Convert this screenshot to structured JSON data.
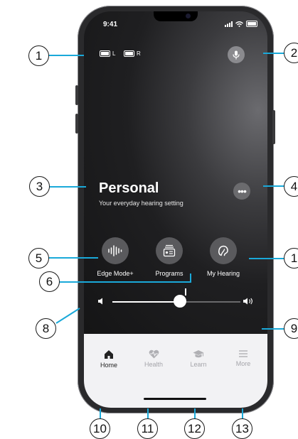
{
  "status_bar": {
    "time": "9:41"
  },
  "hearing_aids": {
    "left_label": "L",
    "right_label": "R"
  },
  "program": {
    "name": "Personal",
    "description": "Your everyday hearing setting"
  },
  "features": [
    {
      "label": "Edge Mode+",
      "icon": "waveform-icon"
    },
    {
      "label": "Programs",
      "icon": "radio-icon"
    },
    {
      "label": "My Hearing",
      "icon": "ear-icon"
    }
  ],
  "volume": {
    "level": 0.53
  },
  "tabs": [
    {
      "label": "Home",
      "icon": "house-icon",
      "active": true
    },
    {
      "label": "Health",
      "icon": "heart-pulse-icon",
      "active": false
    },
    {
      "label": "Learn",
      "icon": "graduation-cap-icon",
      "active": false
    },
    {
      "label": "More",
      "icon": "menu-icon",
      "active": false
    }
  ],
  "callouts": [
    "1",
    "2",
    "3",
    "4",
    "5",
    "6",
    "1",
    "8",
    "9",
    "10",
    "11",
    "12",
    "13"
  ],
  "colors": {
    "callout_line": "#1aa9d9",
    "tab_active": "#222222",
    "tab_inactive": "#a5a5aa"
  }
}
